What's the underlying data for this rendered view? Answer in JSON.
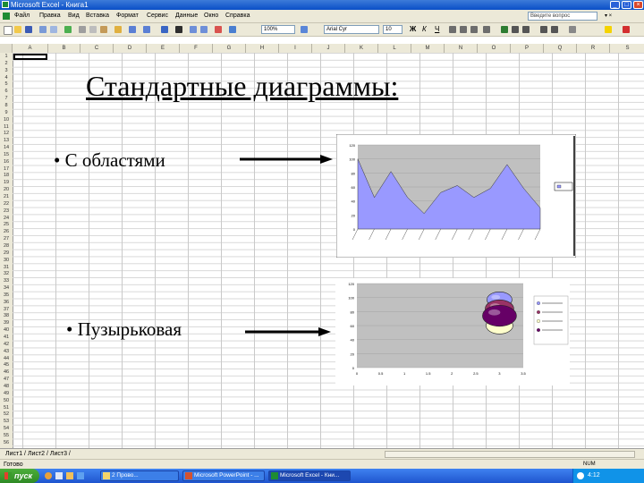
{
  "window": {
    "title": "Microsoft Excel - Книга1",
    "app_icon": "excel-icon"
  },
  "menu": {
    "items": [
      "Файл",
      "Правка",
      "Вид",
      "Вставка",
      "Формат",
      "Сервис",
      "Данные",
      "Окно",
      "Справка"
    ],
    "help_placeholder": "Введите вопрос"
  },
  "toolbar": {
    "zoom": "100%",
    "font_name": "Arial Cyr",
    "font_size": "10"
  },
  "columns": [
    "A",
    "B",
    "C",
    "D",
    "E",
    "F",
    "G",
    "H",
    "I",
    "J",
    "K",
    "L",
    "M",
    "N",
    "O",
    "P",
    "Q",
    "R",
    "S"
  ],
  "rows": [
    "1",
    "2",
    "3",
    "4",
    "5",
    "6",
    "7",
    "8",
    "9",
    "10",
    "11",
    "12",
    "13",
    "14",
    "15",
    "16",
    "17",
    "18",
    "19",
    "20",
    "21",
    "22",
    "23",
    "24",
    "25",
    "26",
    "27",
    "28",
    "29",
    "30",
    "31",
    "32",
    "33",
    "34",
    "35",
    "36",
    "37",
    "38",
    "39",
    "40",
    "41",
    "42",
    "43",
    "44",
    "45",
    "46",
    "47",
    "48",
    "49",
    "50",
    "51",
    "52",
    "53",
    "54",
    "55",
    "56"
  ],
  "slide": {
    "title": "Стандартные диаграммы:",
    "bullet1": "С областями",
    "bullet2": "Пузырьковая",
    "bullet_char": "•"
  },
  "chart_data": [
    {
      "type": "area",
      "values": [
        100,
        45,
        82,
        45,
        22,
        52,
        62,
        45,
        58,
        92,
        58,
        30
      ],
      "ylim": [
        0,
        120
      ],
      "yticks": [
        0,
        20,
        40,
        60,
        80,
        100,
        120
      ],
      "fill_color": "#9999ff",
      "plot_bg": "#c0c0c0",
      "legend": "right"
    },
    {
      "type": "scatter",
      "subtype": "bubble",
      "ylim": [
        0,
        120
      ],
      "yticks": [
        0,
        20,
        40,
        60,
        80,
        100,
        120
      ],
      "xlim": [
        0,
        3.5
      ],
      "xticks": [
        0,
        0.5,
        1,
        1.5,
        2,
        2.5,
        3,
        3.5
      ],
      "points": [
        {
          "x": 3,
          "y": 97,
          "size": 14,
          "color": "#9999ff"
        },
        {
          "x": 3,
          "y": 84,
          "size": 16,
          "color": "#993366"
        },
        {
          "x": 3,
          "y": 60,
          "size": 15,
          "color": "#ffffcc"
        },
        {
          "x": 3,
          "y": 74,
          "size": 19,
          "color": "#660066"
        }
      ],
      "plot_bg": "#c0c0c0",
      "legend": "right"
    }
  ],
  "tabs": {
    "label": "Лист1 / Лист2 / Лист3 /"
  },
  "status": {
    "text": "Готово",
    "num": "NUM"
  },
  "taskbar": {
    "start": "пуск",
    "tasks": [
      "2 Прово...",
      "Microsoft PowerPoint - ...",
      "Microsoft Excel - Кни..."
    ],
    "clock": "4:12"
  },
  "colors": {
    "title_bar": "#0a4fc7",
    "taskbar": "#2458d3",
    "start": "#3a9a2c",
    "chrome": "#ece9d8"
  }
}
